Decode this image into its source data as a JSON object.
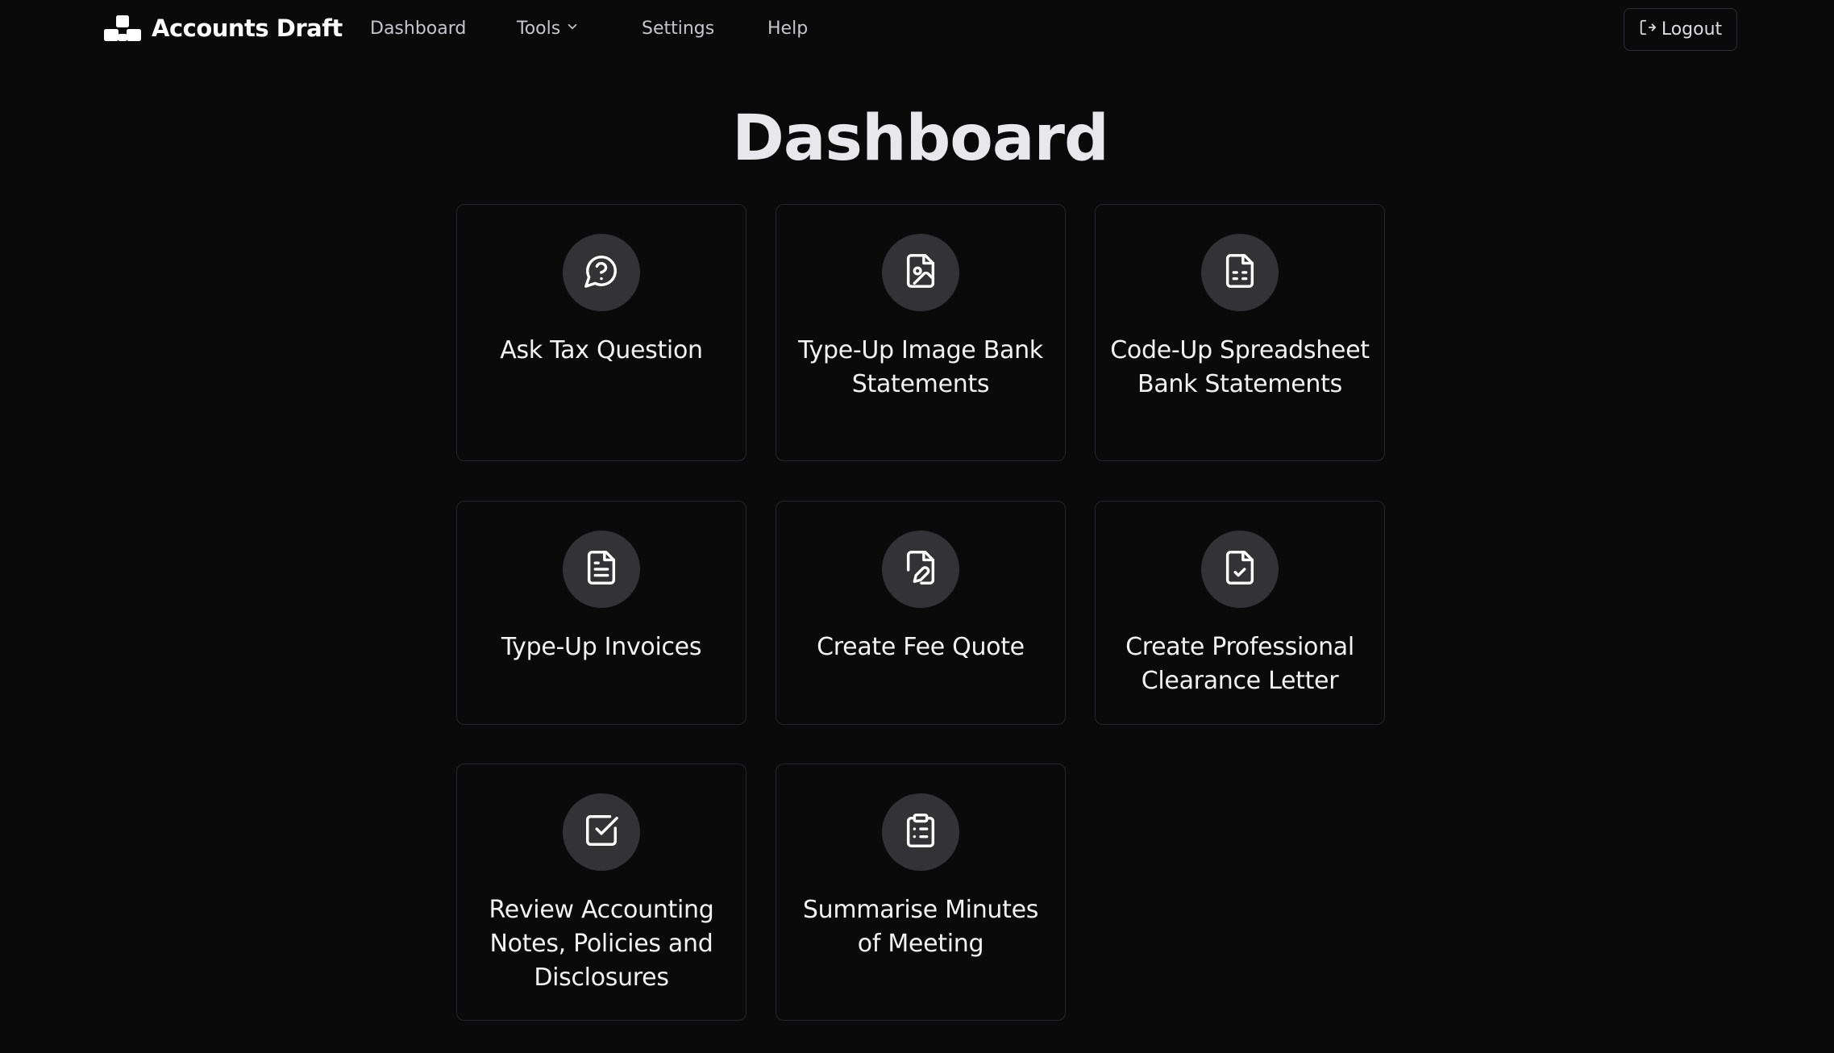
{
  "brand": {
    "name": "Accounts Draft",
    "icon": "stacked-blocks-logo-icon"
  },
  "nav": {
    "dashboard": "Dashboard",
    "tools": "Tools",
    "settings": "Settings",
    "help": "Help"
  },
  "logout": {
    "label": "Logout",
    "icon": "logout-icon"
  },
  "page": {
    "title": "Dashboard"
  },
  "cards": [
    {
      "label": "Ask Tax Question",
      "icon": "chat-question-icon"
    },
    {
      "label": "Type-Up Image Bank Statements",
      "icon": "file-image-icon"
    },
    {
      "label": "Code-Up Spreadsheet Bank Statements",
      "icon": "file-spreadsheet-icon"
    },
    {
      "label": "Type-Up Invoices",
      "icon": "file-text-icon"
    },
    {
      "label": "Create Fee Quote",
      "icon": "file-pen-icon"
    },
    {
      "label": "Create Professional Clearance Letter",
      "icon": "file-check-icon"
    },
    {
      "label": "Review Accounting Notes, Policies and Disclosures",
      "icon": "square-check-icon"
    },
    {
      "label": "Summarise Minutes of Meeting",
      "icon": "clipboard-list-icon"
    }
  ],
  "colors": {
    "background": "#0a0a0b",
    "card_border": "#26262a",
    "icon_circle": "#333335",
    "text": "#ffffff",
    "nav_text": "#c6c6c9"
  }
}
